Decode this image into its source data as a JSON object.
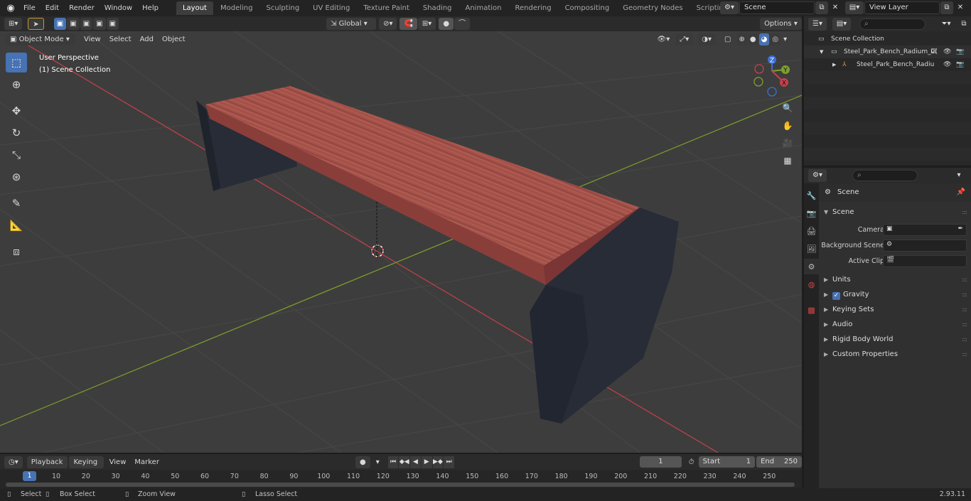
{
  "menu": [
    "File",
    "Edit",
    "Render",
    "Window",
    "Help"
  ],
  "workspaces": [
    "Layout",
    "Modeling",
    "Sculpting",
    "UV Editing",
    "Texture Paint",
    "Shading",
    "Animation",
    "Rendering",
    "Compositing",
    "Geometry Nodes",
    "Scripting"
  ],
  "active_workspace": "Layout",
  "scene_name": "Scene",
  "view_layer": "View Layer",
  "viewport": {
    "mode": "Object Mode",
    "menus": [
      "View",
      "Select",
      "Add",
      "Object"
    ],
    "transform_orientation": "Global",
    "options_label": "Options",
    "overlay_line1": "User Perspective",
    "overlay_line2": "(1) Scene Collection",
    "gizmo_axes": {
      "x": "X",
      "y": "Y",
      "z": "Z"
    }
  },
  "outliner": {
    "collection": "Scene Collection",
    "item1": "Steel_Park_Bench_Radium_0(",
    "item2": "Steel_Park_Bench_Radiu"
  },
  "properties": {
    "context": "Scene",
    "panel_scene": "Scene",
    "camera_label": "Camera",
    "bg_scene_label": "Background Scene",
    "active_clip_label": "Active Clip",
    "panels": [
      "Units",
      "Gravity",
      "Keying Sets",
      "Audio",
      "Rigid Body World",
      "Custom Properties"
    ],
    "gravity_checked": true
  },
  "timeline": {
    "menus": [
      "Playback",
      "Keying",
      "View",
      "Marker"
    ],
    "current_frame": "1",
    "start_label": "Start",
    "start_value": "1",
    "end_label": "End",
    "end_value": "250",
    "ticks": [
      "10",
      "20",
      "30",
      "40",
      "50",
      "60",
      "70",
      "80",
      "90",
      "100",
      "110",
      "120",
      "130",
      "140",
      "150",
      "160",
      "170",
      "180",
      "190",
      "200",
      "210",
      "220",
      "230",
      "240",
      "250"
    ],
    "cursor_frame": "1"
  },
  "statusbar": {
    "select": "Select",
    "box_select": "Box Select",
    "zoom_view": "Zoom View",
    "lasso_select": "Lasso Select",
    "version": "2.93.11"
  },
  "colors": {
    "accent": "#4772b3",
    "wood": "#a4514a",
    "bench_leg": "#272c37",
    "x_axis": "#c8404a",
    "y_axis": "#7fa02a"
  }
}
